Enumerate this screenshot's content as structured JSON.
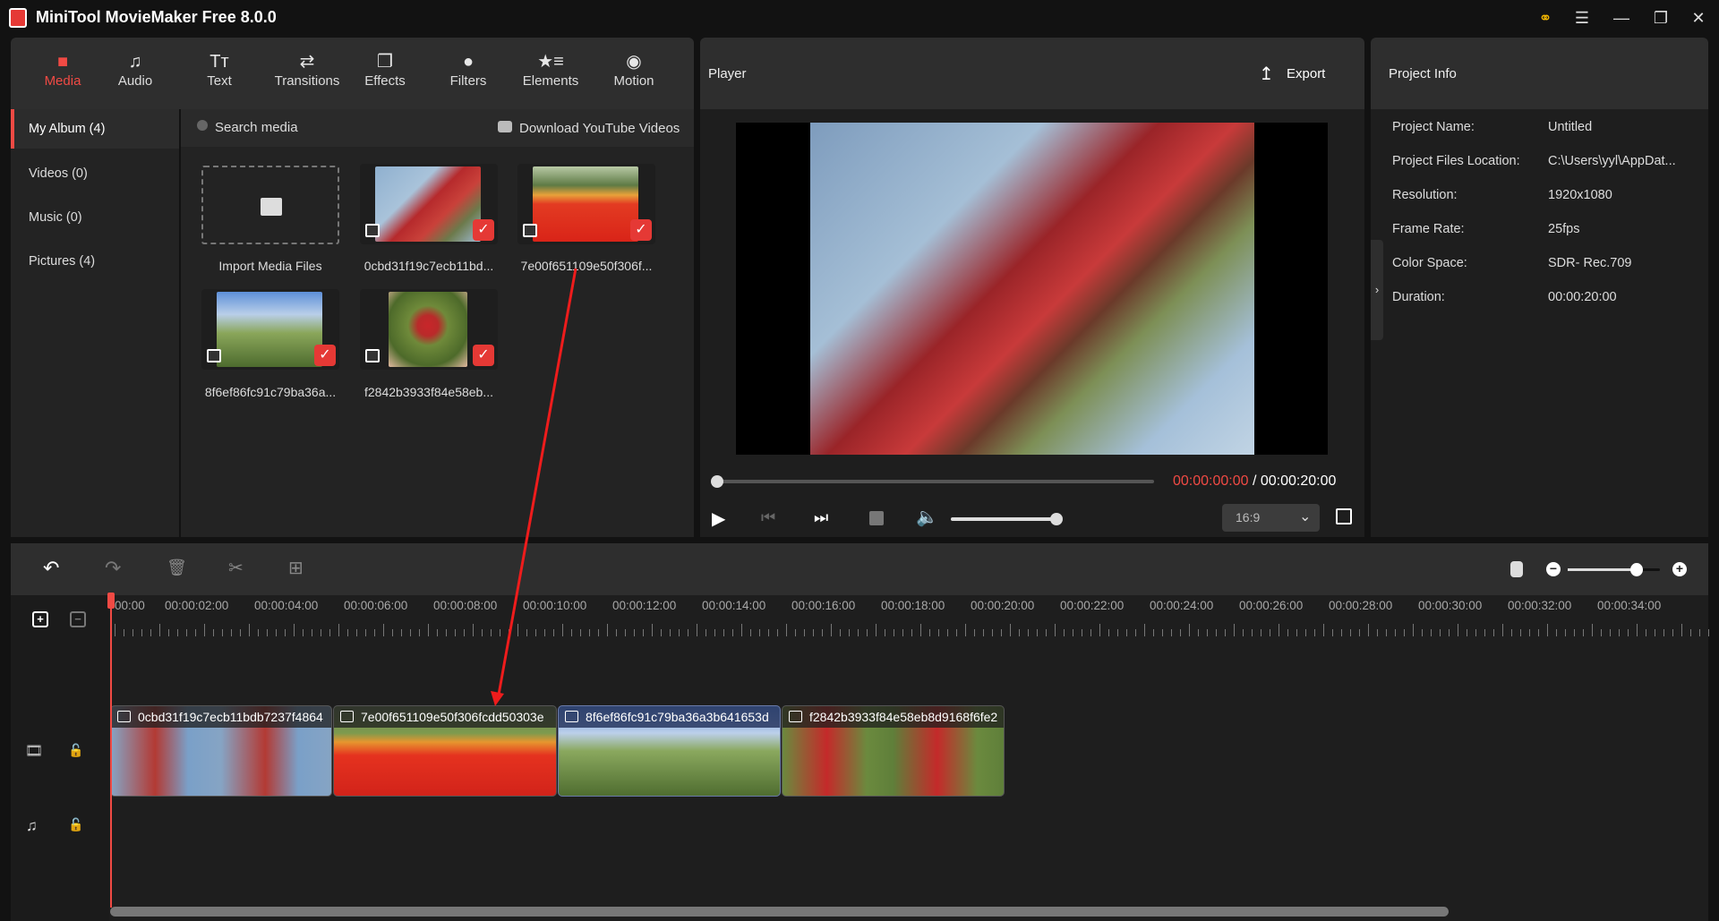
{
  "app": {
    "title": "MiniTool MovieMaker Free 8.0.0"
  },
  "window_controls": {
    "key": "key-icon",
    "menu": "menu-icon",
    "minimize": "minimize-icon",
    "restore": "restore-icon",
    "close": "close-icon"
  },
  "tabs": [
    {
      "label": "Media",
      "icon": "folder-icon",
      "active": true
    },
    {
      "label": "Audio",
      "icon": "music-icon"
    },
    {
      "label": "Text",
      "icon": "text-icon"
    },
    {
      "label": "Transitions",
      "icon": "transitions-icon"
    },
    {
      "label": "Effects",
      "icon": "effects-icon"
    },
    {
      "label": "Filters",
      "icon": "filters-icon"
    },
    {
      "label": "Elements",
      "icon": "elements-icon"
    },
    {
      "label": "Motion",
      "icon": "motion-icon"
    }
  ],
  "sidebar": {
    "items": [
      {
        "label": "My Album (4)",
        "active": true
      },
      {
        "label": "Videos (0)"
      },
      {
        "label": "Music (0)"
      },
      {
        "label": "Pictures (4)"
      }
    ]
  },
  "media": {
    "search_placeholder": "Search media",
    "download_label": "Download YouTube Videos",
    "import_label": "Import Media Files",
    "items": [
      {
        "label": "0cbd31f19c7ecb11bd...",
        "checked": true
      },
      {
        "label": "7e00f651109e50f306f...",
        "checked": true
      },
      {
        "label": "8f6ef86fc91c79ba36a...",
        "checked": true
      },
      {
        "label": "f2842b3933f84e58eb...",
        "checked": true
      }
    ]
  },
  "player": {
    "title": "Player",
    "export_label": "Export",
    "current_time": "00:00:00:00",
    "separator": " / ",
    "total_time": "00:00:20:00",
    "progress": 0,
    "volume": 1.0,
    "aspect_ratio": "16:9"
  },
  "project_info": {
    "title": "Project Info",
    "rows": [
      {
        "label": "Project Name:",
        "value": "Untitled"
      },
      {
        "label": "Project Files Location:",
        "value": "C:\\Users\\yyl\\AppDat..."
      },
      {
        "label": "Resolution:",
        "value": "1920x1080"
      },
      {
        "label": "Frame Rate:",
        "value": "25fps"
      },
      {
        "label": "Color Space:",
        "value": "SDR- Rec.709"
      },
      {
        "label": "Duration:",
        "value": "00:00:20:00"
      }
    ]
  },
  "timeline": {
    "zoom_level": 0.75,
    "ruler": [
      "00:00",
      "00:00:02:00",
      "00:00:04:00",
      "00:00:06:00",
      "00:00:08:00",
      "00:00:10:00",
      "00:00:12:00",
      "00:00:14:00",
      "00:00:16:00",
      "00:00:18:00",
      "00:00:20:00",
      "00:00:22:00",
      "00:00:24:00",
      "00:00:26:00",
      "00:00:28:00",
      "00:00:30:00",
      "00:00:32:00",
      "00:00:34:00"
    ],
    "clips": [
      {
        "label": "0cbd31f19c7ecb11bdb7237f4864"
      },
      {
        "label": "7e00f651109e50f306fcdd50303e"
      },
      {
        "label": "8f6ef86fc91c79ba36a3b641653d"
      },
      {
        "label": "f2842b3933f84e58eb8d9168f6fe2"
      }
    ]
  },
  "colors": {
    "accent": "#f04a44",
    "check": "#e53935",
    "key": "#f5b800"
  }
}
